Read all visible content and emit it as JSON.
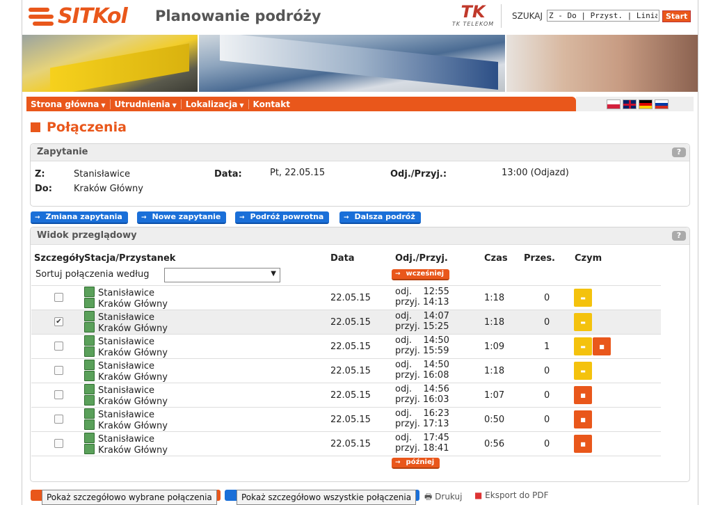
{
  "header": {
    "brand": "SITKol",
    "title": "Planowanie podróży",
    "partner": "TK TELEKOM",
    "search_label": "SZUKAJ",
    "search_value": "Z - Do | Przyst. | Linia",
    "start": "Start"
  },
  "nav": [
    "Strona główna",
    "Utrudnienia",
    "Lokalizacja",
    "Kontakt"
  ],
  "page_title": "Połączenia",
  "query": {
    "heading": "Zapytanie",
    "help": "?",
    "from_label": "Z:",
    "from": "Stanisławice",
    "to_label": "Do:",
    "to": "Kraków Główny",
    "date_label": "Data:",
    "date": "Pt, 22.05.15",
    "time_label": "Odj./Przyj.:",
    "time": "13:00 (Odjazd)"
  },
  "actions": [
    "Zmiana zapytania",
    "Nowe zapytanie",
    "Podróż powrotna",
    "Dalsza podróż"
  ],
  "overview": {
    "heading": "Widok przeglądowy",
    "help": "?",
    "cols": {
      "details": "Szczegóły",
      "station": "Stacja/Przystanek",
      "date": "Data",
      "time": "Odj./Przyj.",
      "duration": "Czas",
      "changes": "Przes.",
      "by": "Czym"
    },
    "sort_label": "Sortuj połączenia według",
    "earlier": "wcześniej",
    "later": "później"
  },
  "rows": [
    {
      "checked": false,
      "from": "Stanisławice",
      "to": "Kraków Główny",
      "date": "22.05.15",
      "dep": "12:55",
      "arr": "14:13",
      "dur": "1:18",
      "chg": "0",
      "veh": [
        "y"
      ]
    },
    {
      "checked": true,
      "from": "Stanisławice",
      "to": "Kraków Główny",
      "date": "22.05.15",
      "dep": "14:07",
      "arr": "15:25",
      "dur": "1:18",
      "chg": "0",
      "veh": [
        "y"
      ]
    },
    {
      "checked": false,
      "from": "Stanisławice",
      "to": "Kraków Główny",
      "date": "22.05.15",
      "dep": "14:50",
      "arr": "15:59",
      "dur": "1:09",
      "chg": "1",
      "veh": [
        "y",
        "o"
      ]
    },
    {
      "checked": false,
      "from": "Stanisławice",
      "to": "Kraków Główny",
      "date": "22.05.15",
      "dep": "14:50",
      "arr": "16:08",
      "dur": "1:18",
      "chg": "0",
      "veh": [
        "y"
      ]
    },
    {
      "checked": false,
      "from": "Stanisławice",
      "to": "Kraków Główny",
      "date": "22.05.15",
      "dep": "14:56",
      "arr": "16:03",
      "dur": "1:07",
      "chg": "0",
      "veh": [
        "o"
      ]
    },
    {
      "checked": false,
      "from": "Stanisławice",
      "to": "Kraków Główny",
      "date": "22.05.15",
      "dep": "16:23",
      "arr": "17:13",
      "dur": "0:50",
      "chg": "0",
      "veh": [
        "o"
      ]
    },
    {
      "checked": false,
      "from": "Stanisławice",
      "to": "Kraków Główny",
      "date": "22.05.15",
      "dep": "17:45",
      "arr": "18:41",
      "dur": "0:56",
      "chg": "0",
      "veh": [
        "o"
      ]
    }
  ],
  "labels": {
    "odj": "odj.",
    "przyj": "przyj."
  },
  "bottom": {
    "show_selected": "Pokaż szczegółowo wybrane połączenia",
    "show_all": "Pokaż szczegółowo wszystkie połączenia",
    "print": "Drukuj",
    "pdf": "Eksport do PDF"
  },
  "colors": {
    "accent": "#e9571b",
    "blue": "#1a6fd8",
    "bus_yellow": "#f4c20d"
  }
}
